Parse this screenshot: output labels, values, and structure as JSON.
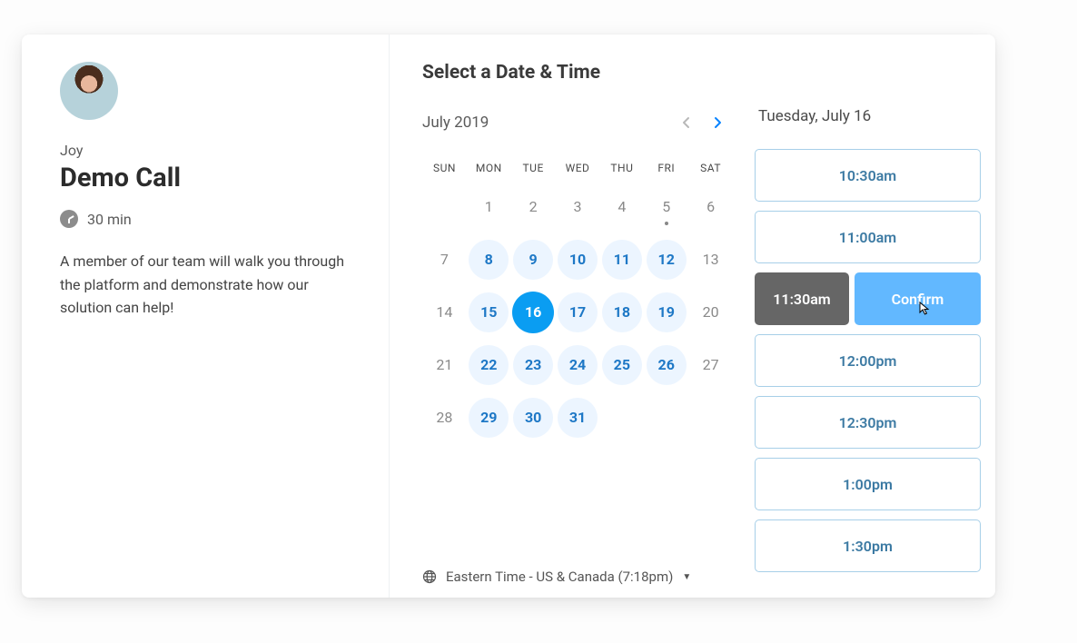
{
  "host": {
    "name": "Joy"
  },
  "event": {
    "title": "Demo Call",
    "duration_label": "30 min",
    "description": "A member of our team will walk you through the platform and demonstrate how our solution can help!"
  },
  "heading": "Select a Date & Time",
  "calendar": {
    "month_label": "July 2019",
    "dow": [
      "SUN",
      "MON",
      "TUE",
      "WED",
      "THU",
      "FRI",
      "SAT"
    ],
    "start_blank": 1,
    "days": [
      {
        "n": 1,
        "avail": false
      },
      {
        "n": 2,
        "avail": false
      },
      {
        "n": 3,
        "avail": false
      },
      {
        "n": 4,
        "avail": false
      },
      {
        "n": 5,
        "avail": false,
        "today": true
      },
      {
        "n": 6,
        "avail": false
      },
      {
        "n": 7,
        "avail": false
      },
      {
        "n": 8,
        "avail": true
      },
      {
        "n": 9,
        "avail": true
      },
      {
        "n": 10,
        "avail": true
      },
      {
        "n": 11,
        "avail": true
      },
      {
        "n": 12,
        "avail": true
      },
      {
        "n": 13,
        "avail": false
      },
      {
        "n": 14,
        "avail": false
      },
      {
        "n": 15,
        "avail": true
      },
      {
        "n": 16,
        "avail": true,
        "selected": true
      },
      {
        "n": 17,
        "avail": true
      },
      {
        "n": 18,
        "avail": true
      },
      {
        "n": 19,
        "avail": true
      },
      {
        "n": 20,
        "avail": false
      },
      {
        "n": 21,
        "avail": false
      },
      {
        "n": 22,
        "avail": true
      },
      {
        "n": 23,
        "avail": true
      },
      {
        "n": 24,
        "avail": true
      },
      {
        "n": 25,
        "avail": true
      },
      {
        "n": 26,
        "avail": true
      },
      {
        "n": 27,
        "avail": false
      },
      {
        "n": 28,
        "avail": false
      },
      {
        "n": 29,
        "avail": true
      },
      {
        "n": 30,
        "avail": true
      },
      {
        "n": 31,
        "avail": true
      }
    ]
  },
  "timezone": {
    "label": "Eastern Time - US & Canada (7:18pm)"
  },
  "times": {
    "date_heading": "Tuesday, July 16",
    "confirm_label": "Confirm",
    "slots": [
      {
        "label": "10:30am",
        "selected": false
      },
      {
        "label": "11:00am",
        "selected": false
      },
      {
        "label": "11:30am",
        "selected": true
      },
      {
        "label": "12:00pm",
        "selected": false
      },
      {
        "label": "12:30pm",
        "selected": false
      },
      {
        "label": "1:00pm",
        "selected": false
      },
      {
        "label": "1:30pm",
        "selected": false
      }
    ]
  }
}
